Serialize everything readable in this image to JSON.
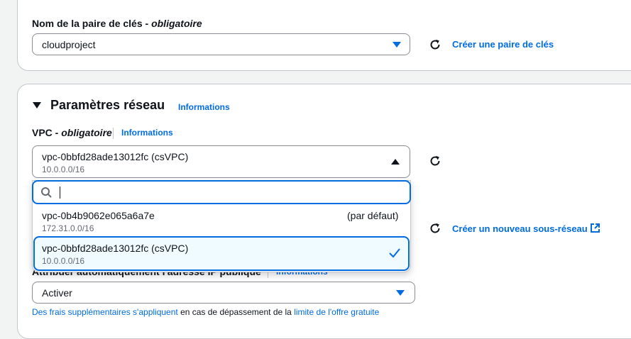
{
  "keypair": {
    "label": "Nom de la paire de clés",
    "label_suffix": " - ",
    "required": "obligatoire",
    "value": "cloudproject",
    "create_link": "Créer une paire de clés"
  },
  "network": {
    "title": "Paramètres réseau",
    "info": "Informations",
    "vpc": {
      "label": "VPC",
      "label_suffix": " - ",
      "required": "obligatoire",
      "info": "Informations",
      "selected_name": "vpc-0bbfd28ade13012fc (csVPC)",
      "selected_cidr": "10.0.0.0/16",
      "search_value": "",
      "options": [
        {
          "name": "vpc-0b4b9062e065a6a7e",
          "cidr": "172.31.0.0/16",
          "tag": "(par défaut)"
        },
        {
          "name": "vpc-0bbfd28ade13012fc (csVPC)",
          "cidr": "10.0.0.0/16",
          "tag": ""
        }
      ]
    },
    "subnet_create_link": "Créer un nouveau sous-réseau",
    "public_ip": {
      "label": "Attribuer automatiquement l'adresse IP publique",
      "info": "Informations",
      "value": "Activer"
    },
    "footnote": {
      "link1": "Des frais supplémentaires s'appliquent",
      "text": " en cas de dépassement de la ",
      "link2": "limite de l'offre gratuite"
    }
  },
  "colors": {
    "accent": "#006ce0",
    "text": "#0f141a",
    "muted": "#656871",
    "selected_bg": "#f0fbff"
  },
  "icons": [
    "refresh-icon",
    "caret-down-icon",
    "caret-up-icon",
    "search-icon",
    "check-icon",
    "external-link-icon"
  ]
}
